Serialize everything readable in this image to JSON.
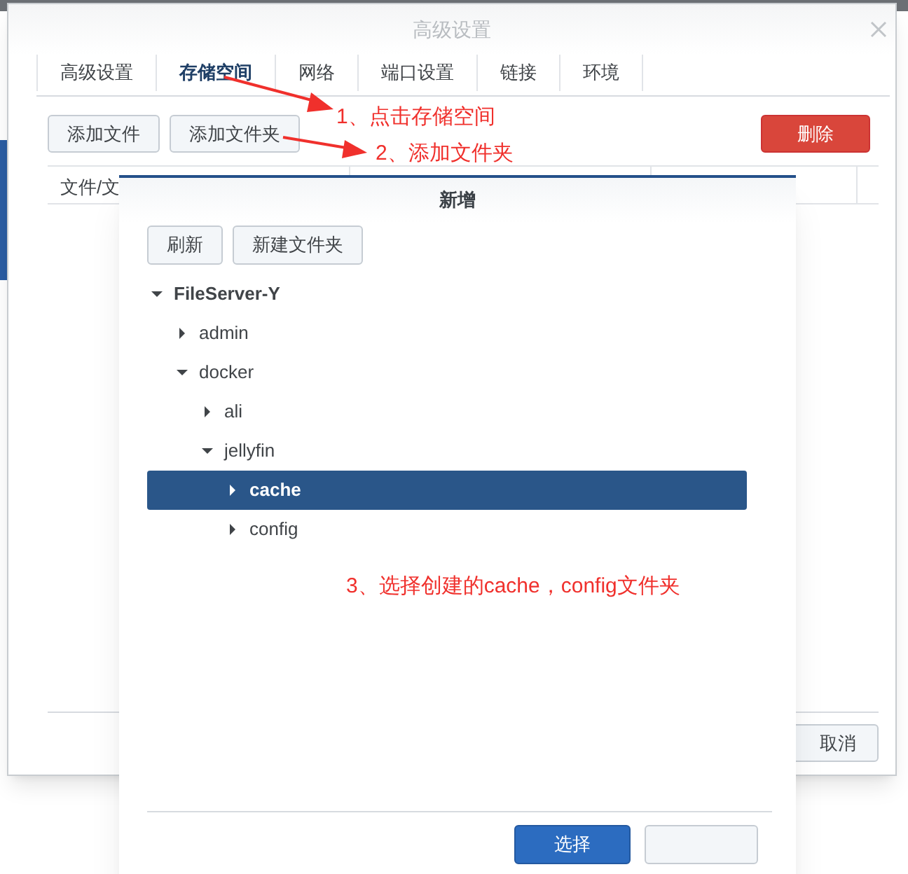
{
  "window": {
    "title": "高级设置"
  },
  "tabs": [
    {
      "label": "高级设置",
      "selected": false
    },
    {
      "label": "存储空间",
      "selected": true
    },
    {
      "label": "网络",
      "selected": false
    },
    {
      "label": "端口设置",
      "selected": false
    },
    {
      "label": "链接",
      "selected": false
    },
    {
      "label": "环境",
      "selected": false
    }
  ],
  "toolbar": {
    "buttons": [
      "添加文件",
      "添加文件夹"
    ],
    "delete_button": "删除"
  },
  "table": {
    "columns": [
      "文件/文"
    ]
  },
  "footer": {
    "cancel_button": "取消"
  },
  "dialog": {
    "title": "新增",
    "buttons": [
      "刷新",
      "新建文件夹"
    ],
    "tree": [
      {
        "label": "FileServer-Y",
        "expanded": true,
        "selected": false,
        "children": [
          {
            "label": "admin",
            "expanded": false,
            "selected": false
          },
          {
            "label": "docker",
            "expanded": true,
            "selected": false,
            "children": [
              {
                "label": "ali",
                "expanded": false,
                "selected": false
              },
              {
                "label": "jellyfin",
                "expanded": true,
                "selected": false,
                "children": [
                  {
                    "label": "cache",
                    "expanded": false,
                    "selected": true
                  },
                  {
                    "label": "config",
                    "expanded": false,
                    "selected": false
                  }
                ]
              }
            ]
          }
        ]
      }
    ],
    "select_button": "选择"
  },
  "annotations": [
    "1、点击存储空间",
    "2、添加文件夹",
    "3、选择创建的cache，config文件夹"
  ]
}
